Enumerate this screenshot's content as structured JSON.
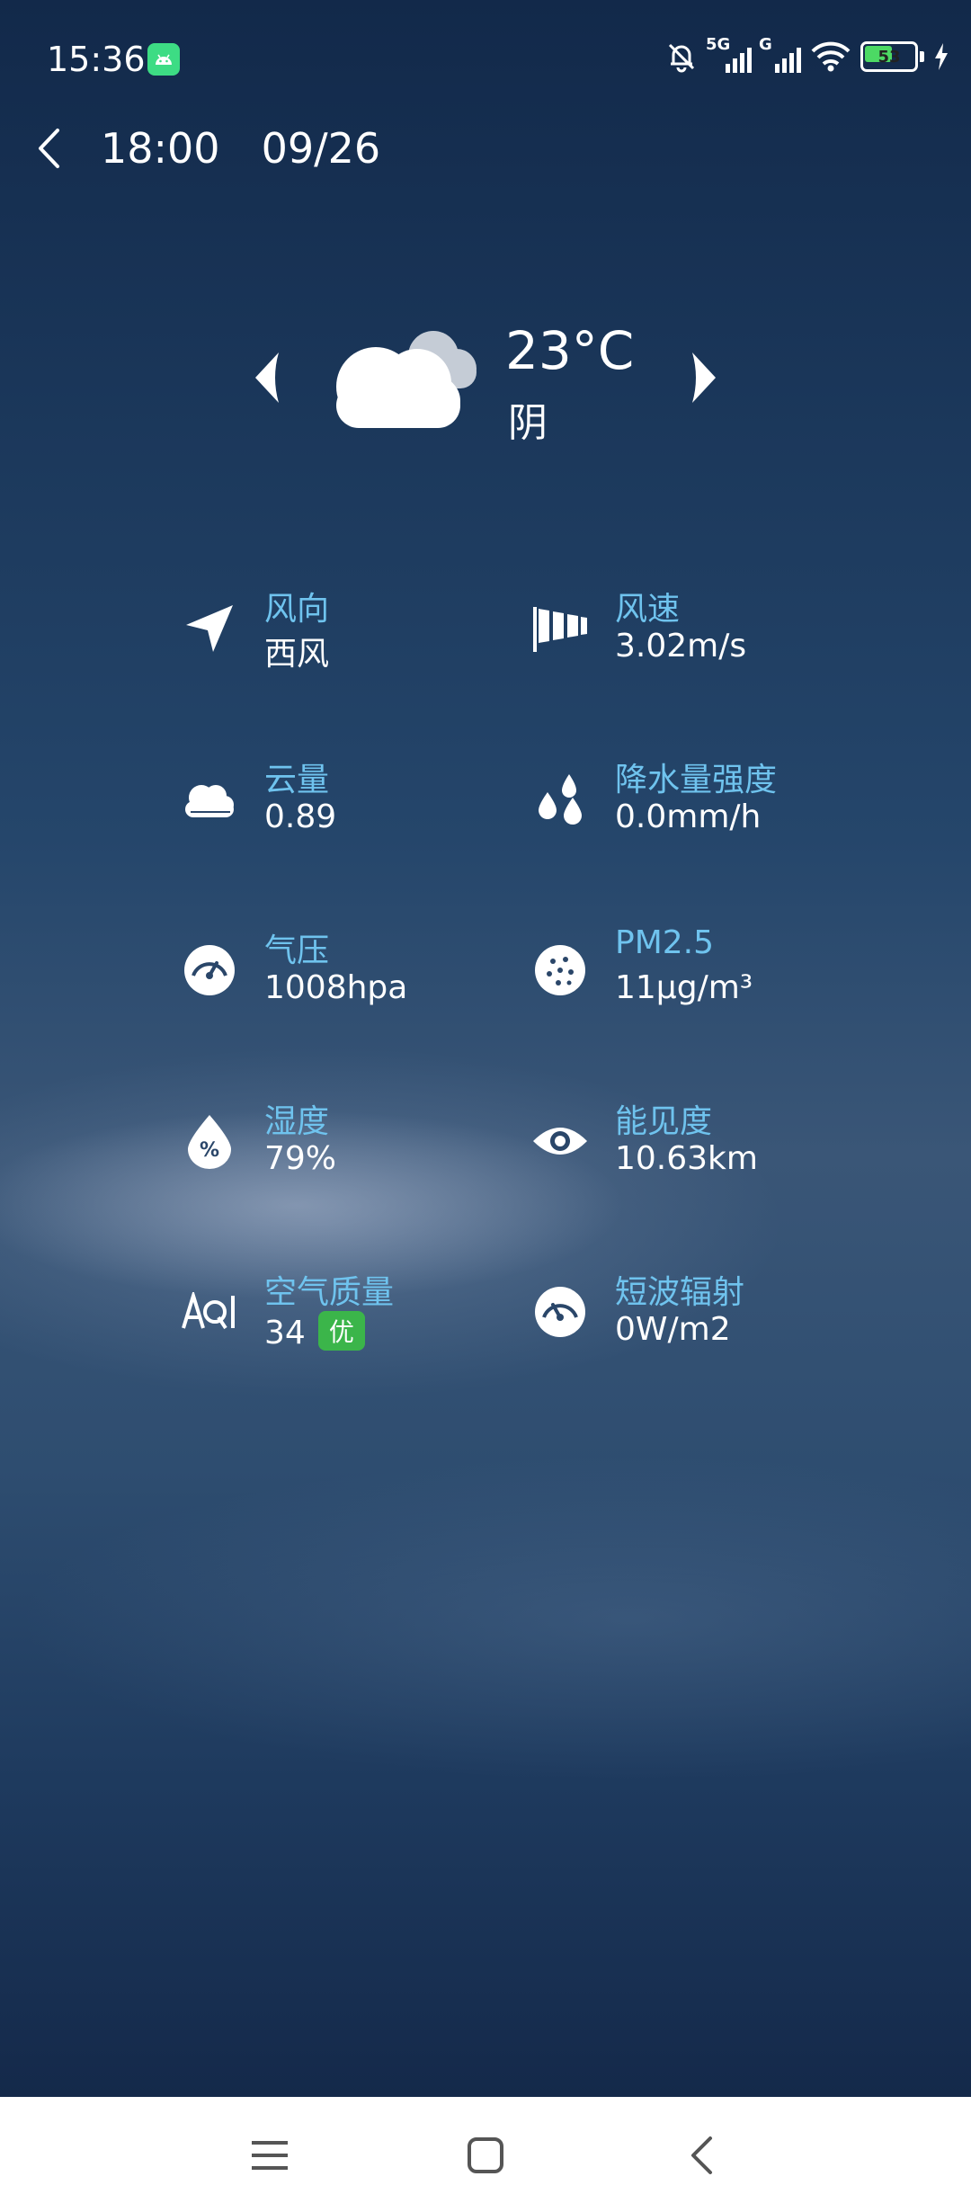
{
  "status_bar": {
    "time": "15:36",
    "signal1_label": "5G",
    "signal2_label": "G",
    "battery_level": "53",
    "icons": [
      "android-icon",
      "bell-off-icon",
      "signal-icon",
      "wifi-icon",
      "battery-icon",
      "charging-icon"
    ]
  },
  "header": {
    "time": "18:00",
    "date": "09/26"
  },
  "weather": {
    "temperature": "23°C",
    "condition": "阴",
    "icon": "cloudy-icon"
  },
  "details": [
    {
      "label": "风向",
      "value": "西风",
      "icon": "wind-direction-icon"
    },
    {
      "label": "风速",
      "value": "3.02m/s",
      "icon": "windsock-icon"
    },
    {
      "label": "云量",
      "value": "0.89",
      "icon": "cloud-icon"
    },
    {
      "label": "降水量强度",
      "value": "0.0mm/h",
      "icon": "raindrops-icon"
    },
    {
      "label": "气压",
      "value": "1008hpa",
      "icon": "pressure-gauge-icon"
    },
    {
      "label": "PM2.5",
      "value": "11μg/m³",
      "icon": "particles-icon"
    },
    {
      "label": "湿度",
      "value": "79%",
      "icon": "humidity-icon"
    },
    {
      "label": "能见度",
      "value": "10.63km",
      "icon": "eye-icon"
    },
    {
      "label": "空气质量",
      "value": "34",
      "badge": "优",
      "icon": "aqi-icon"
    },
    {
      "label": "短波辐射",
      "value": "0W/m2",
      "icon": "radiation-gauge-icon"
    }
  ],
  "colors": {
    "label": "#6fc3ee",
    "badge": "#3bb54a",
    "nav_bar": "#ffffff"
  }
}
